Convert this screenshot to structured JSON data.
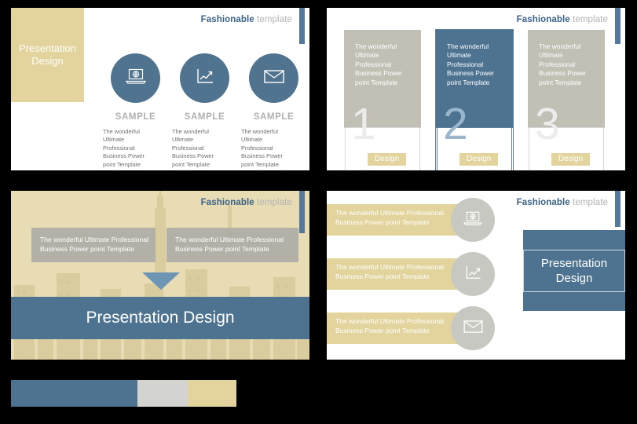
{
  "header": {
    "brand": "Fashionable",
    "suffix": "template"
  },
  "slide1": {
    "panel_title": "Presentation\nDesign",
    "items": [
      {
        "icon": "laptop-globe-icon",
        "label": "SAMPLE",
        "body": "The wonderful Ultimate Professional Business Power point Template"
      },
      {
        "icon": "line-chart-icon",
        "label": "SAMPLE",
        "body": "The wonderful Ultimate Professional Business Power point Template"
      },
      {
        "icon": "envelope-icon",
        "label": "SAMPLE",
        "body": "The wonderful Ultimate Professional Business Power point Template"
      }
    ]
  },
  "slide2": {
    "columns": [
      {
        "text": "The wonderful Ultimate Professional Business Power point Template",
        "number": "1",
        "button": "Design",
        "highlighted": false
      },
      {
        "text": "The wonderful Ultimate Professional Business Power point Template",
        "number": "2",
        "button": "Design",
        "highlighted": true
      },
      {
        "text": "The wonderful Ultimate Professional Business Power point Template",
        "number": "3",
        "button": "Design",
        "highlighted": false
      }
    ]
  },
  "slide3": {
    "boxes": [
      {
        "text": "The wonderful Ultimate Professional Business Power point Template"
      },
      {
        "text": "The wonderful Ultimate Professional Business Power point Template"
      }
    ],
    "arrow": "down-triangle-icon",
    "banner": "Presentation Design"
  },
  "slide4": {
    "rows": [
      {
        "text": "The wonderful Ultimate Professional Business Power point Template",
        "icon": "laptop-globe-icon"
      },
      {
        "text": "The wonderful Ultimate Professional Business Power point Template",
        "icon": "line-chart-icon"
      },
      {
        "text": "The wonderful Ultimate Professional Business Power point Template",
        "icon": "envelope-icon"
      }
    ],
    "box_title": "Presentation\nDesign"
  },
  "palette": {
    "swatches": [
      {
        "name": "blue",
        "hex": "#4e7391"
      },
      {
        "name": "gray",
        "hex": "#d3d4d0"
      },
      {
        "name": "khaki",
        "hex": "#e2d49c"
      }
    ],
    "accent_blue": "#4e7391",
    "accent_khaki": "#e2d49c",
    "accent_gray": "#c2c0b5",
    "brand_blue": "#3b6387"
  }
}
